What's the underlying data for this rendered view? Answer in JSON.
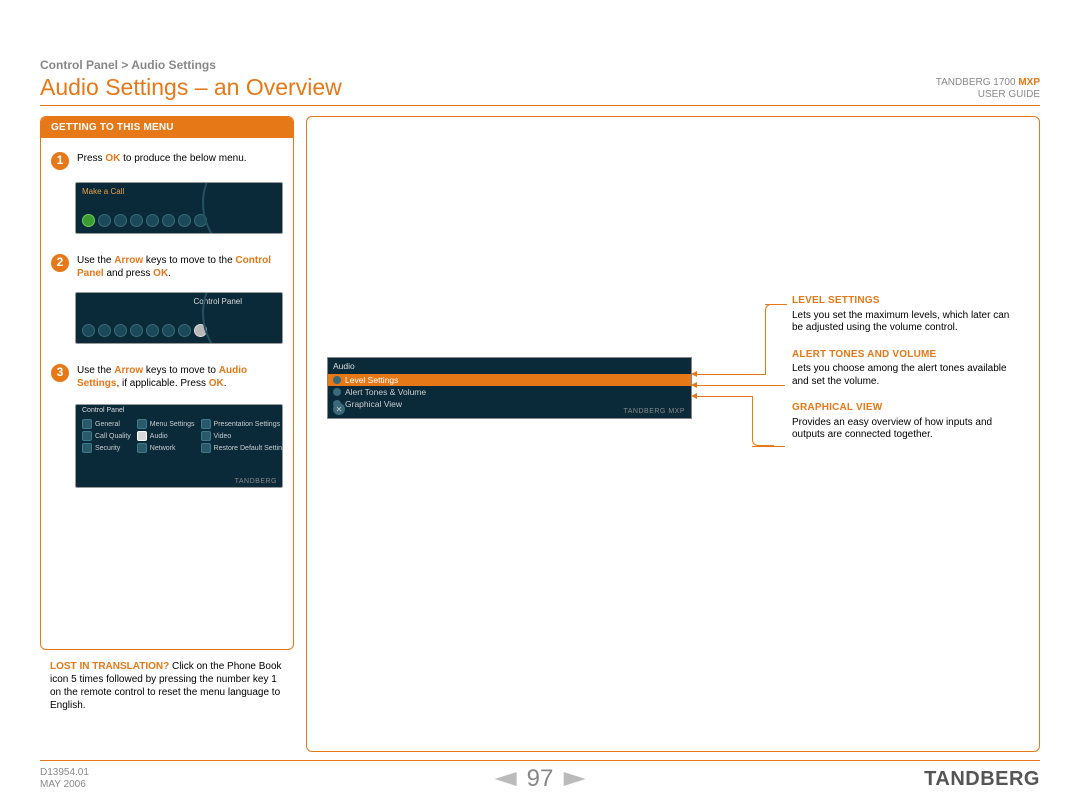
{
  "breadcrumb": "Control Panel > Audio Settings",
  "title": "Audio Settings – an Overview",
  "product": {
    "name": "TANDBERG 1700",
    "suffix": "MXP",
    "subtitle": "USER GUIDE"
  },
  "sidebar": {
    "header": "GETTING TO THIS MENU",
    "step1_a": "Press ",
    "step1_ok": "OK",
    "step1_b": " to produce the below menu.",
    "ss1_label": "Make a Call",
    "step2_a": "Use the ",
    "step2_arrow": "Arrow",
    "step2_b": " keys to move to the ",
    "step2_cp": "Control Panel",
    "step2_c": " and press ",
    "step2_ok": "OK",
    "step2_d": ".",
    "ss2_label": "Control Panel",
    "step3_a": "Use the ",
    "step3_arrow": "Arrow",
    "step3_b": " keys to move to ",
    "step3_as": "Audio Settings",
    "step3_c": ", if applicable. Press ",
    "step3_ok": "OK",
    "step3_d": ".",
    "ss3_title": "Control Panel",
    "ss3_items": [
      "General",
      "Menu Settings",
      "Presentation Settings",
      "Call Quality",
      "Audio",
      "Video",
      "Security",
      "Network",
      "Restore Default Settings"
    ],
    "ss3_brand": "TANDBERG"
  },
  "tip": {
    "lead": "LOST IN TRANSLATION?",
    "rest": " Click on the Phone Book icon 5 times followed by pressing the number key 1 on the remote control to reset the menu language to English."
  },
  "audio_panel": {
    "title": "Audio",
    "rows": [
      "Level Settings",
      "Alert Tones & Volume",
      "Graphical View"
    ],
    "brand": "TANDBERG MXP"
  },
  "callouts": [
    {
      "title": "LEVEL SETTINGS",
      "text": "Lets you set the maximum levels, which later can be adjusted using the volume control."
    },
    {
      "title": "ALERT TONES AND VOLUME",
      "text": "Lets you choose among the alert tones available and set the volume."
    },
    {
      "title": "GRAPHICAL VIEW",
      "text": "Provides an easy overview of how inputs and outputs are connected together."
    }
  ],
  "footer": {
    "doc": "D13954.01",
    "date": "MAY 2006",
    "page": "97",
    "brand": "TANDBERG"
  }
}
